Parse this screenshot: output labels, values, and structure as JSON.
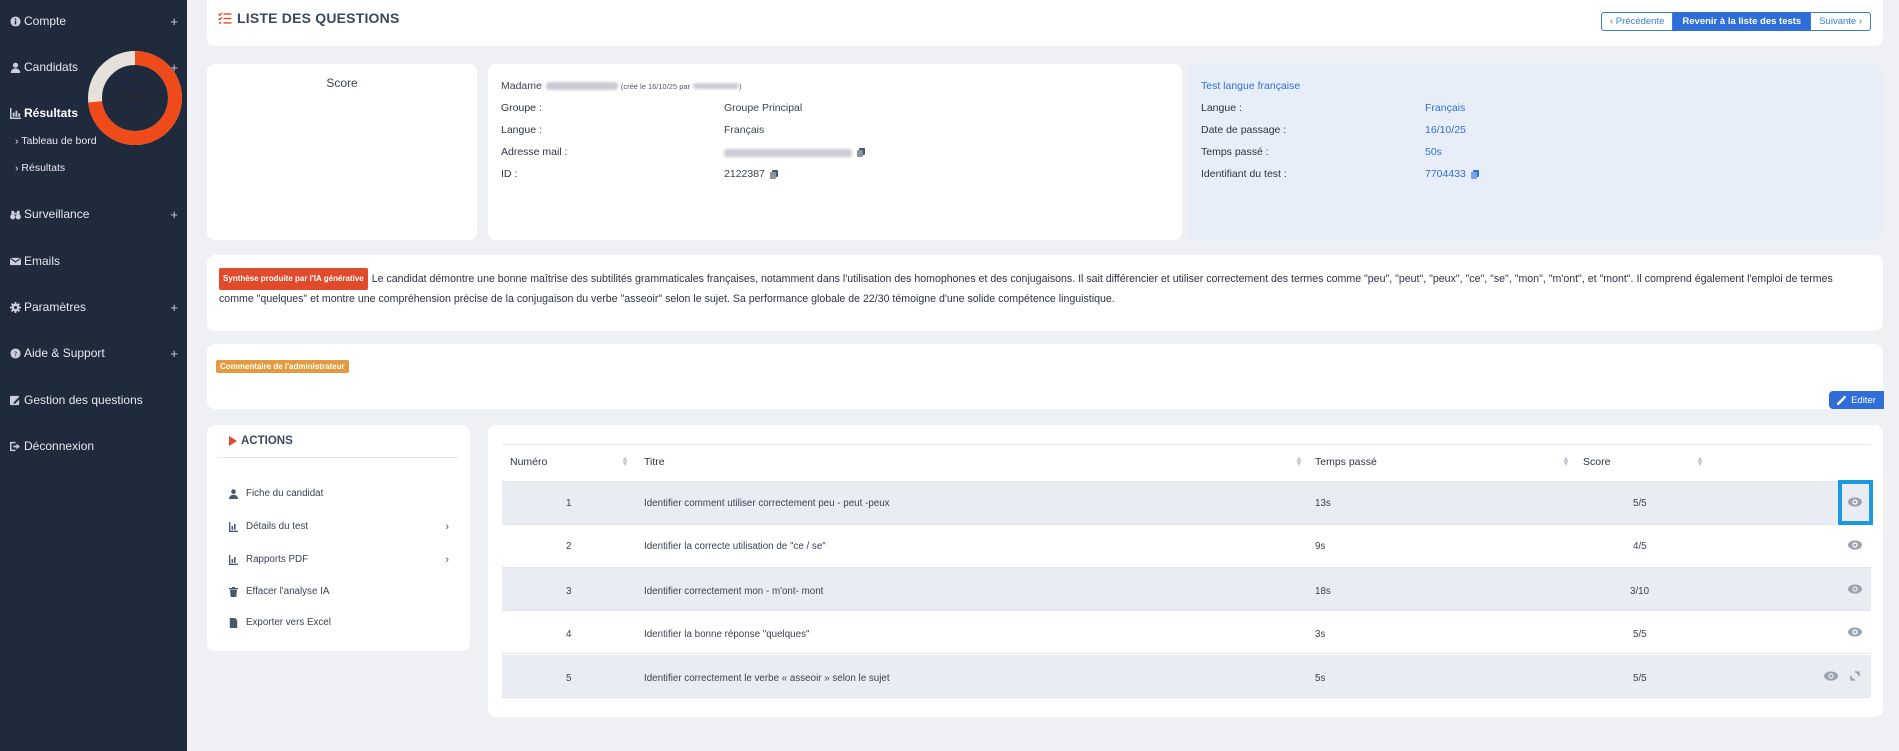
{
  "sidebar": {
    "items": [
      {
        "label": "Compte",
        "icon": "info-icon",
        "expander": "+"
      },
      {
        "label": "Candidats",
        "icon": "user-icon",
        "expander": "+"
      },
      {
        "label": "Résultats",
        "icon": "chart-icon",
        "expander": "−"
      },
      {
        "label": "Surveillance",
        "icon": "binoculars-icon",
        "expander": "+"
      },
      {
        "label": "Emails",
        "icon": "mail-icon",
        "expander": ""
      },
      {
        "label": "Paramètres",
        "icon": "gear-icon",
        "expander": "+"
      },
      {
        "label": "Aide & Support",
        "icon": "help-icon",
        "expander": "+"
      },
      {
        "label": "Gestion des questions",
        "icon": "edit-icon",
        "expander": ""
      },
      {
        "label": "Déconnexion",
        "icon": "logout-icon",
        "expander": ""
      }
    ],
    "sub_items": [
      "› Tableau de bord",
      "› Résultats"
    ]
  },
  "header": {
    "title": "LISTE DES QUESTIONS",
    "prev": "‹  Précédente",
    "back": "Revenir à la liste des tests",
    "next": "Suivante  ›"
  },
  "score": {
    "title": "Score",
    "label": "22/30",
    "value": 22,
    "max": 30,
    "color_fill": "#ef4a1a",
    "color_track": "#e5e2dc"
  },
  "candidate": {
    "salutation": "Madame",
    "created": "(créé le 16/10/25 par",
    "created_end": ")",
    "labels": {
      "group": "Groupe :",
      "language": "Langue :",
      "email": "Adresse mail :",
      "id": "ID :"
    },
    "values": {
      "group": "Groupe Principal",
      "language": "Français",
      "id": "2122387"
    }
  },
  "test": {
    "title": "Test langue française",
    "labels": {
      "language": "Langue :",
      "date": "Date de passage :",
      "time": "Temps passé :",
      "test_id": "Identifiant du test :"
    },
    "values": {
      "language": "Français",
      "date": "16/10/25",
      "time": "50s",
      "test_id": "7704433"
    }
  },
  "ai": {
    "badge": "Synthèse produite par l'IA générative",
    "text": "Le candidat démontre une bonne maîtrise des subtilités grammaticales françaises, notamment dans l'utilisation des homophones et des conjugaisons. Il sait différencier et utiliser correctement des termes comme \"peu\", \"peut\", \"peux\", \"ce\", \"se\", \"mon\", \"m'ont\", et \"mont\". Il comprend également l'emploi de termes comme \"quelques\" et montre une compréhension précise de la conjugaison du verbe \"asseoir\" selon le sujet. Sa performance globale de 22/30 témoigne d'une solide compétence linguistique."
  },
  "admin": {
    "badge": "Commentaire de l'administrateur",
    "edit": "Editer"
  },
  "actions": {
    "title": "ACTIONS",
    "items": [
      {
        "label": "Fiche du candidat",
        "icon": "user-icon",
        "chevron": ""
      },
      {
        "label": "Détails du test",
        "icon": "chart-icon",
        "chevron": "›"
      },
      {
        "label": "Rapports PDF",
        "icon": "chart-icon",
        "chevron": "›"
      },
      {
        "label": "Effacer l'analyse IA",
        "icon": "trash-icon",
        "chevron": ""
      },
      {
        "label": "Exporter vers Excel",
        "icon": "file-icon",
        "chevron": ""
      }
    ]
  },
  "table": {
    "headers": {
      "num": "Numéro",
      "title": "Titre",
      "time": "Temps passé",
      "score": "Score"
    },
    "rows": [
      {
        "num": "1",
        "title": "Identifier comment utiliser correctement peu - peut -peux",
        "time": "13s",
        "score": "5/5"
      },
      {
        "num": "2",
        "title": "Identifier la correcte utilisation de \"ce / se\"",
        "time": "9s",
        "score": "4/5"
      },
      {
        "num": "3",
        "title": "Identifier correctement mon - m'ont- mont",
        "time": "18s",
        "score": "3/10"
      },
      {
        "num": "4",
        "title": "Identifier la bonne réponse \"quelques\"",
        "time": "3s",
        "score": "5/5"
      },
      {
        "num": "5",
        "title": "Identifier correctement le verbe « asseoir » selon le sujet",
        "time": "5s",
        "score": "5/5"
      }
    ]
  }
}
